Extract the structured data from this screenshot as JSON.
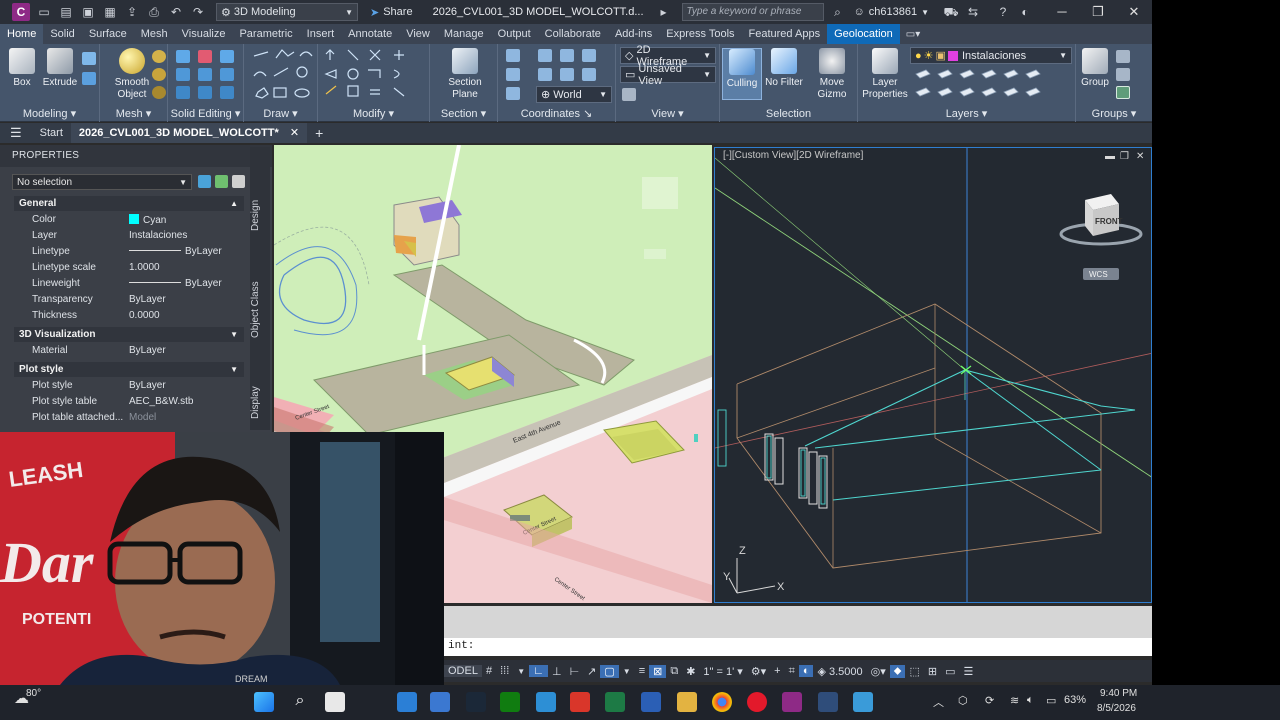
{
  "titlebar": {
    "workspace": "3D Modeling",
    "share": "Share",
    "document_title": "2026_CVL001_3D MODEL_WOLCOTT.d...",
    "search_placeholder": "Type a keyword or phrase",
    "username": "ch613861"
  },
  "ribbon_tabs": [
    "Home",
    "Solid",
    "Surface",
    "Mesh",
    "Visualize",
    "Parametric",
    "Insert",
    "Annotate",
    "View",
    "Manage",
    "Output",
    "Collaborate",
    "Add-ins",
    "Express Tools",
    "Featured Apps",
    "Geolocation"
  ],
  "ribbon": {
    "modeling": {
      "title": "Modeling",
      "box": "Box",
      "extrude": "Extrude"
    },
    "mesh": {
      "title": "Mesh",
      "smooth_object": "Smooth Object"
    },
    "solid_editing": {
      "title": "Solid Editing"
    },
    "draw": {
      "title": "Draw"
    },
    "modify": {
      "title": "Modify"
    },
    "section": {
      "title": "Section",
      "section_plane": "Section Plane"
    },
    "coordinates": {
      "title": "Coordinates",
      "ucs": "World"
    },
    "view": {
      "title": "View",
      "visual_style": "2D Wireframe",
      "named_view": "Unsaved View"
    },
    "selection": {
      "title": "Selection",
      "culling": "Culling",
      "no_filter": "No Filter",
      "move_gizmo": "Move Gizmo"
    },
    "layers": {
      "title": "Layers",
      "layer_properties": "Layer Properties",
      "current_layer": "Instalaciones"
    },
    "groups": {
      "title": "Groups",
      "group": "Group"
    }
  },
  "file_tabs": {
    "start": "Start",
    "active": "2026_CVL001_3D MODEL_WOLCOTT*"
  },
  "properties": {
    "header": "PROPERTIES",
    "selection": "No selection",
    "sections": {
      "general": "General",
      "viz": "3D Visualization",
      "plot": "Plot style"
    },
    "general_rows": [
      {
        "k": "Color",
        "v": "Cyan"
      },
      {
        "k": "Layer",
        "v": "Instalaciones"
      },
      {
        "k": "Linetype",
        "v": "ByLayer"
      },
      {
        "k": "Linetype scale",
        "v": "1.0000"
      },
      {
        "k": "Lineweight",
        "v": "ByLayer"
      },
      {
        "k": "Transparency",
        "v": "ByLayer"
      },
      {
        "k": "Thickness",
        "v": "0.0000"
      }
    ],
    "viz_rows": [
      {
        "k": "Material",
        "v": "ByLayer"
      }
    ],
    "plot_rows": [
      {
        "k": "Plot style",
        "v": "ByLayer"
      },
      {
        "k": "Plot style table",
        "v": "AEC_B&W.stb"
      },
      {
        "k": "Plot table attached...",
        "v": "Model"
      }
    ],
    "vertical_tabs": [
      "Design",
      "Object Class",
      "Display"
    ],
    "color_swatch": "#00ffff"
  },
  "viewports": {
    "left": {
      "streets": [
        "East 4th Avenue",
        "Center Street",
        "Center Street",
        "Center Street"
      ]
    },
    "right": {
      "label": "[-][Custom View][2D Wireframe]",
      "viewcube_face": "FRONT",
      "wcs": "WCS",
      "axis_z": "Z",
      "axis_x": "X",
      "axis_y": "Y"
    }
  },
  "command_line": {
    "prompt": "int:"
  },
  "statusbar": {
    "model": "ODEL",
    "annotation_scale": "1\" = 1'",
    "linetype_scale": "3.5000"
  },
  "webcam": {
    "brand_text": "LEASH",
    "script_text": "Dar",
    "potential": "POTENTI",
    "shirt_text": "DREAM"
  },
  "taskbar": {
    "weather": "80°",
    "battery": "63%",
    "time": "9:40 PM",
    "date": "8/5/2026"
  },
  "colors": {
    "accent": "#0f6ab8",
    "cyan": "#00ffff",
    "ribbon_bg": "#45556b"
  }
}
